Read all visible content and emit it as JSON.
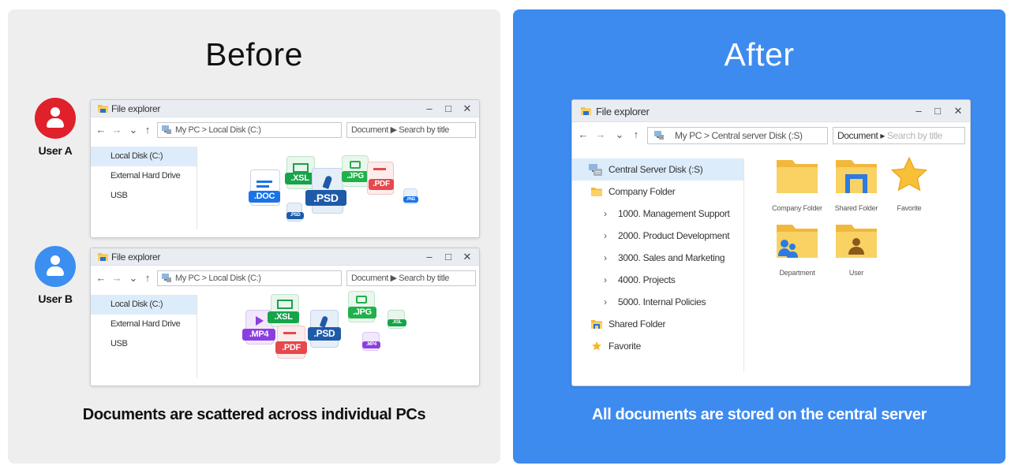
{
  "before": {
    "title": "Before",
    "caption": "Documents are scattered across individual PCs",
    "users": [
      {
        "label": "User A",
        "color": "#e0202a"
      },
      {
        "label": "User B",
        "color": "#3a8ff0"
      }
    ],
    "window": {
      "title": "File explorer",
      "address": "My PC  >  Local Disk (C:)",
      "search": "Document ▶ Search by title",
      "sidebar": [
        "Local Disk (C:)",
        "External Hard Drive",
        "USB"
      ]
    },
    "files_a": [
      ".DOC",
      ".XSL",
      ".PSD",
      ".JPG",
      ".PDF",
      ".PSD",
      ".PNG"
    ],
    "files_b": [
      ".MP4",
      ".XSL",
      ".PSD",
      ".JPG",
      ".XSL",
      ".PDF",
      ".MP4"
    ]
  },
  "after": {
    "title": "After",
    "caption": "All documents are stored on the central server",
    "window": {
      "title": "File explorer",
      "address": "My PC  >  Central server Disk (:S)",
      "search_prefix": "Document ▸",
      "search_placeholder": "Search by title",
      "tree": {
        "root": "Central Server Disk (:S)",
        "company": "Company Folder",
        "children": [
          "1000. Management Support",
          "2000. Product Development",
          "3000. Sales and Marketing",
          "4000. Projects",
          "5000. Internal Policies"
        ],
        "shared": "Shared Folder",
        "favorite": "Favorite"
      },
      "grid": [
        "Company Folder",
        "Shared Folder",
        "Favorite",
        "Department",
        "User"
      ]
    }
  },
  "colors": {
    "doc_blue": "#1a73e8",
    "xsl_green": "#17a34a",
    "psd_navy": "#1e5aa8",
    "jpg_green": "#22b04b",
    "pdf_red": "#e5484d",
    "mp4_purple": "#8b3fe0",
    "folder_yellow": "#f6c244"
  }
}
